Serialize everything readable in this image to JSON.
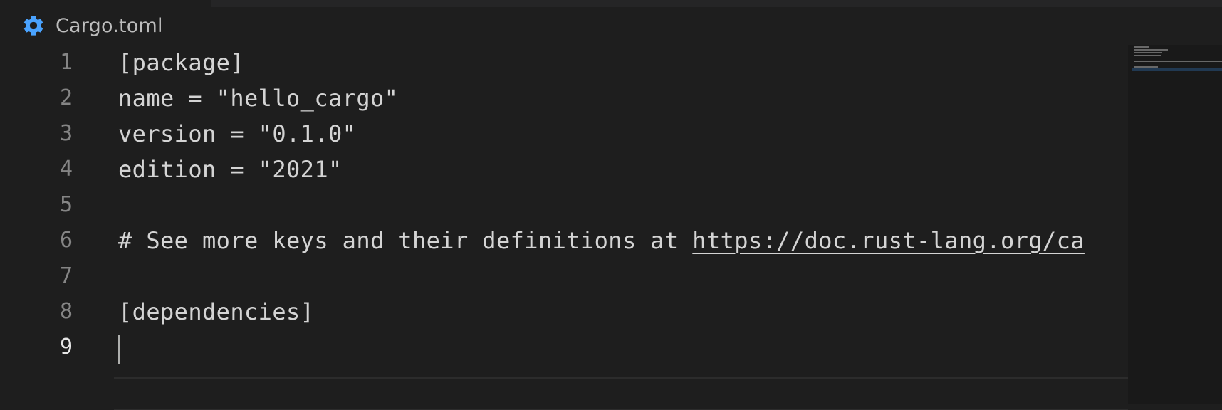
{
  "breadcrumb": {
    "icon": "gear-icon",
    "icon_color": "#4aa3ff",
    "file_name": "Cargo.toml"
  },
  "editor": {
    "current_line": 9,
    "lines": [
      {
        "number": "1",
        "text": "[package]"
      },
      {
        "number": "2",
        "text": "name = \"hello_cargo\""
      },
      {
        "number": "3",
        "text": "version = \"0.1.0\""
      },
      {
        "number": "4",
        "text": "edition = \"2021\""
      },
      {
        "number": "5",
        "text": ""
      },
      {
        "number": "6",
        "text_prefix": "# See more keys and their definitions at ",
        "link": "https://doc.rust-lang.org/ca"
      },
      {
        "number": "7",
        "text": ""
      },
      {
        "number": "8",
        "text": "[dependencies]"
      },
      {
        "number": "9",
        "text": ""
      }
    ]
  },
  "colors": {
    "background": "#1e1e1e",
    "text": "#d4d4d4",
    "line_number": "#858585",
    "line_number_active": "#e6e6e6"
  }
}
